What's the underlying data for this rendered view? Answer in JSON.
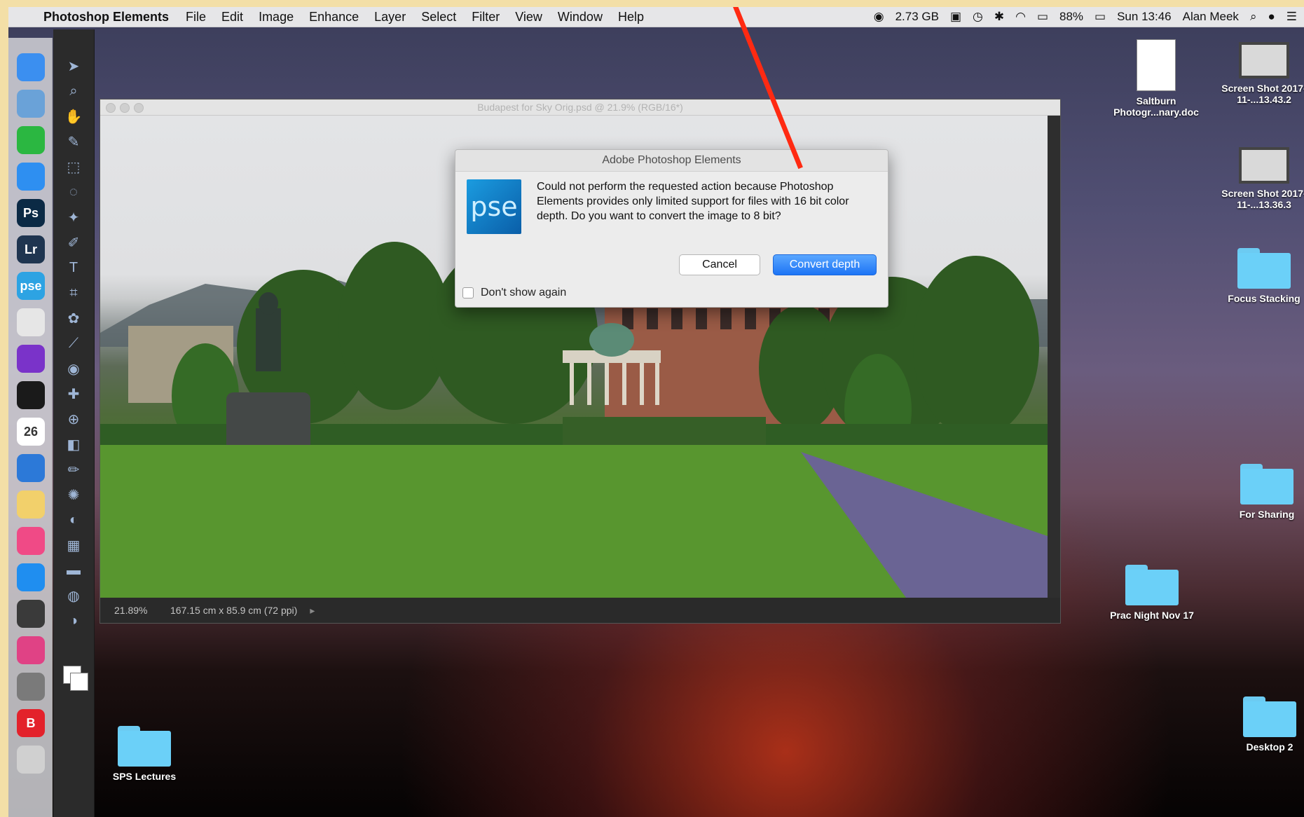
{
  "menubar": {
    "app_name": "Photoshop Elements",
    "menus": [
      "File",
      "Edit",
      "Image",
      "Enhance",
      "Layer",
      "Select",
      "Filter",
      "View",
      "Window",
      "Help"
    ],
    "status": {
      "memory": "2.73 GB",
      "battery": "88%",
      "clock": "Sun 13:46",
      "user": "Alan Meek"
    }
  },
  "dock": {
    "items": [
      {
        "icon": "finder-icon",
        "label": "",
        "color": "#3b8ff0"
      },
      {
        "icon": "preview-icon",
        "label": "",
        "color": "#6aa2d8"
      },
      {
        "icon": "whatsapp-icon",
        "label": "",
        "color": "#2bb741"
      },
      {
        "icon": "safari-icon",
        "label": "",
        "color": "#2e8ff1"
      },
      {
        "icon": "photoshop-icon",
        "label": "Ps",
        "color": "#0b2a45"
      },
      {
        "icon": "lightroom-icon",
        "label": "Lr",
        "color": "#1f3550"
      },
      {
        "icon": "photoshop-elements-icon",
        "label": "pse",
        "color": "#2da3e3"
      },
      {
        "icon": "photos-icon",
        "label": "",
        "color": "#e6e6e6"
      },
      {
        "icon": "affinity-icon",
        "label": "",
        "color": "#7a33c9"
      },
      {
        "icon": "nik-icon",
        "label": "",
        "color": "#1a1a1a"
      },
      {
        "icon": "calendar-icon",
        "label": "26",
        "color": "#ffffff"
      },
      {
        "icon": "keynote-icon",
        "label": "",
        "color": "#2c79d8"
      },
      {
        "icon": "notes-icon",
        "label": "",
        "color": "#f2d06b"
      },
      {
        "icon": "itunes-icon",
        "label": "",
        "color": "#f04a86"
      },
      {
        "icon": "app-store-icon",
        "label": "",
        "color": "#1f8ef0"
      },
      {
        "icon": "battery-widget-icon",
        "label": "",
        "color": "#3a3a3a"
      },
      {
        "icon": "display-icon",
        "label": "",
        "color": "#e04285"
      },
      {
        "icon": "system-preferences-icon",
        "label": "",
        "color": "#7a7a7a"
      },
      {
        "icon": "bitdefender-icon",
        "label": "B",
        "color": "#e3222b"
      },
      {
        "icon": "trash-icon",
        "label": "",
        "color": "#d0d0d0"
      }
    ]
  },
  "tools": [
    "move-tool-icon",
    "zoom-tool-icon",
    "hand-tool-icon",
    "eyedropper-tool-icon",
    "marquee-tool-icon",
    "lasso-tool-icon",
    "magic-wand-tool-icon",
    "selection-brush-icon",
    "type-tool-icon",
    "crop-tool-icon",
    "cookie-cutter-icon",
    "straighten-tool-icon",
    "red-eye-tool-icon",
    "spot-healing-icon",
    "clone-stamp-icon",
    "eraser-tool-icon",
    "brush-tool-icon",
    "smart-brush-icon",
    "paint-bucket-icon",
    "gradient-tool-icon",
    "shape-tool-icon",
    "blur-tool-icon",
    "sponge-tool-icon"
  ],
  "document": {
    "title": "Budapest for Sky Orig.psd @ 21.9% (RGB/16*)",
    "zoom": "21.89%",
    "dimensions": "167.15 cm x 85.9 cm (72 ppi)"
  },
  "dialog": {
    "title": "Adobe Photoshop Elements",
    "logo_text": "pse",
    "message": "Could not perform the requested action because Photoshop Elements provides only limited support for files with 16 bit color depth. Do you want to convert the image to 8 bit?",
    "cancel_label": "Cancel",
    "convert_label": "Convert depth",
    "checkbox_label": "Don't show again"
  },
  "desktop": {
    "items": [
      {
        "type": "doc",
        "label": "Saltburn Photogr...nary.doc"
      },
      {
        "type": "thumb",
        "label": "Screen Shot 2017-11-...13.43.2"
      },
      {
        "type": "thumb",
        "label": "Screen Shot 2017-11-...13.36.3"
      },
      {
        "type": "folder",
        "label": "Focus Stacking"
      },
      {
        "type": "folder",
        "label": "For Sharing"
      },
      {
        "type": "folder",
        "label": "Prac Night Nov 17"
      },
      {
        "type": "folder",
        "label": "Desktop 2"
      },
      {
        "type": "folder",
        "label": "SPS Lectures"
      }
    ]
  }
}
